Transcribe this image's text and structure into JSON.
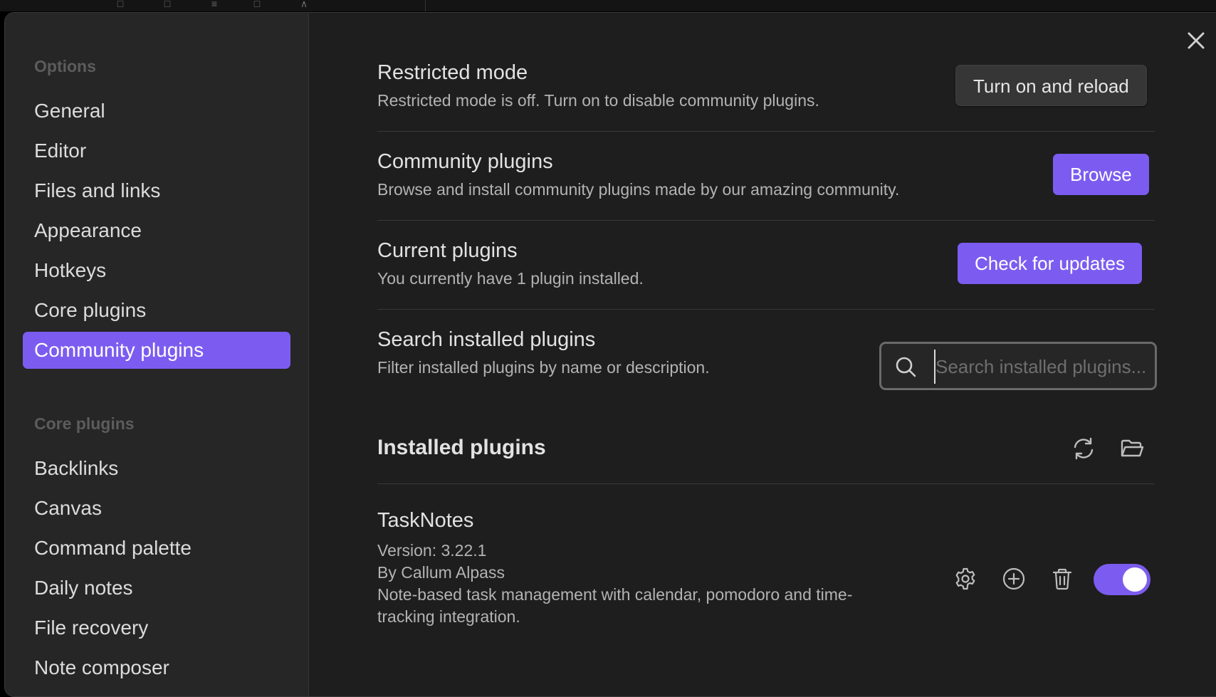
{
  "sidebar": {
    "options_heading": "Options",
    "options_items": [
      {
        "label": "General"
      },
      {
        "label": "Editor"
      },
      {
        "label": "Files and links"
      },
      {
        "label": "Appearance"
      },
      {
        "label": "Hotkeys"
      },
      {
        "label": "Core plugins"
      },
      {
        "label": "Community plugins",
        "active": true
      }
    ],
    "core_heading": "Core plugins",
    "core_items": [
      {
        "label": "Backlinks"
      },
      {
        "label": "Canvas"
      },
      {
        "label": "Command palette"
      },
      {
        "label": "Daily notes"
      },
      {
        "label": "File recovery"
      },
      {
        "label": "Note composer"
      }
    ]
  },
  "settings": {
    "restricted": {
      "name": "Restricted mode",
      "desc": "Restricted mode is off. Turn on to disable community plugins.",
      "button": "Turn on and reload"
    },
    "community": {
      "name": "Community plugins",
      "desc": "Browse and install community plugins made by our amazing community.",
      "button": "Browse"
    },
    "current": {
      "name": "Current plugins",
      "desc": "You currently have 1 plugin installed.",
      "button": "Check for updates"
    },
    "search": {
      "name": "Search installed plugins",
      "desc": "Filter installed plugins by name or description.",
      "placeholder": "Search installed plugins..."
    }
  },
  "installed": {
    "title": "Installed plugins",
    "icons": [
      "refresh-icon",
      "folder-open-icon"
    ],
    "plugins": [
      {
        "name": "TaskNotes",
        "version": "Version: 3.22.1",
        "author": "By Callum Alpass",
        "desc_line1": "Note-based task management with calendar, pomodoro and time-",
        "desc_line2": "tracking integration.",
        "enabled": true
      }
    ]
  },
  "colors": {
    "accent": "#7c5cf0",
    "background": "#1e1e1e",
    "sidebar": "#262626"
  }
}
